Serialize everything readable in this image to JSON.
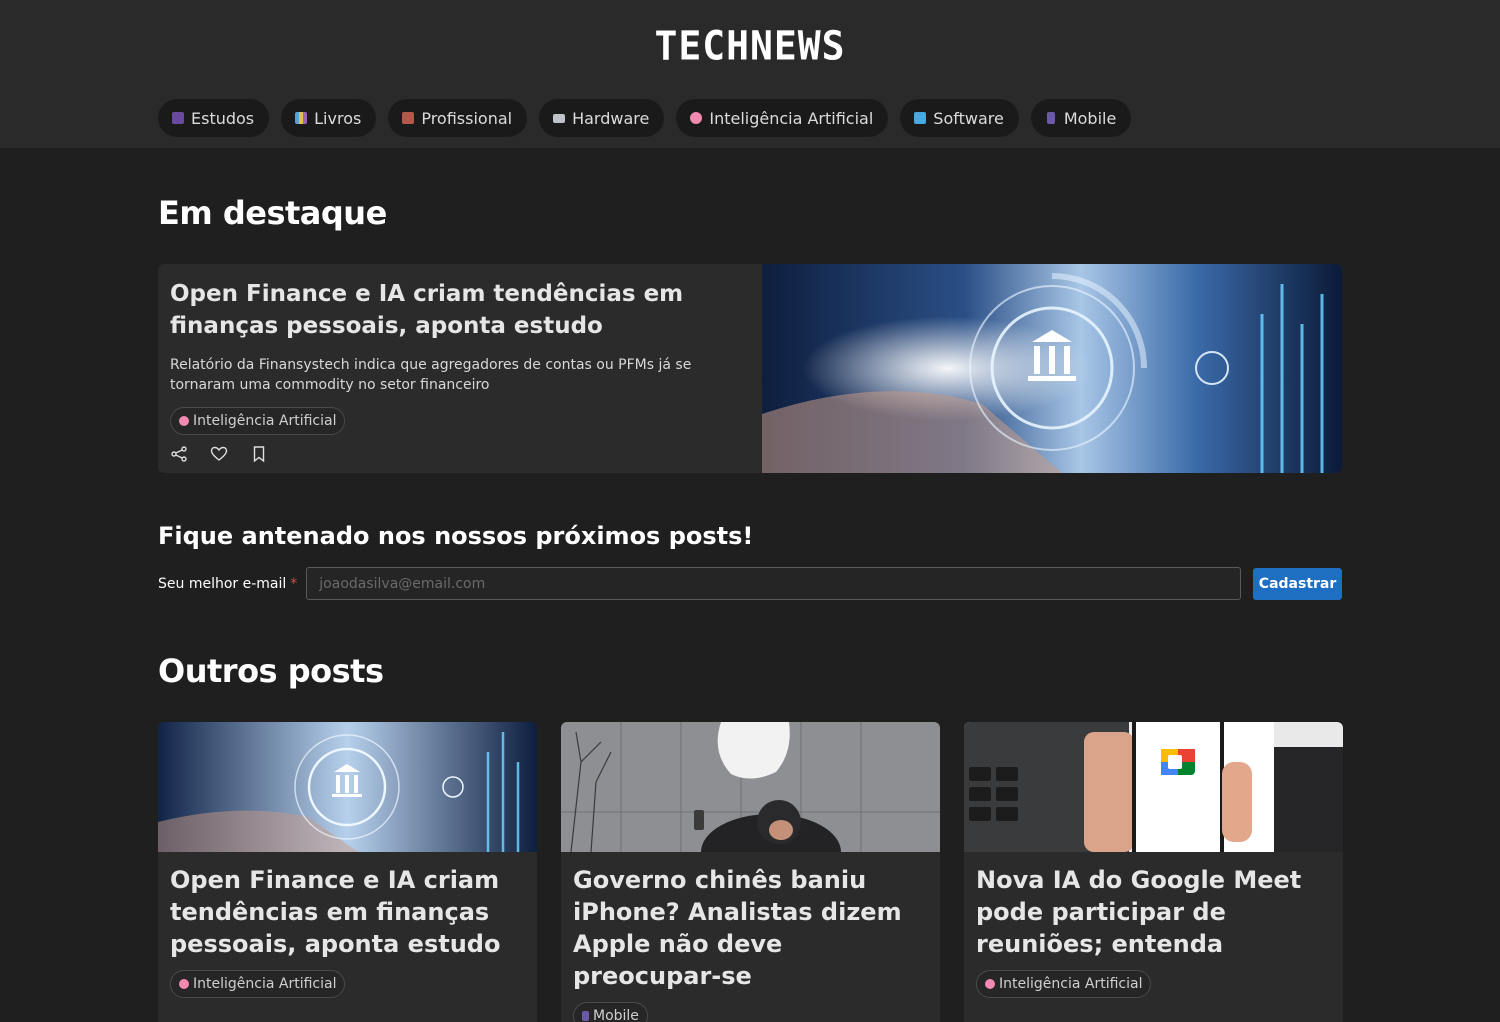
{
  "header": {
    "logo": "TECHNEWS",
    "categories": [
      {
        "label": "Estudos",
        "icon": "graduation-cap-icon",
        "color": "#6a4aa0"
      },
      {
        "label": "Livros",
        "icon": "books-icon",
        "color": "#5aa0d8"
      },
      {
        "label": "Profissional",
        "icon": "briefcase-icon",
        "color": "#b4584a"
      },
      {
        "label": "Hardware",
        "icon": "keyboard-icon",
        "color": "#bfc3c8"
      },
      {
        "label": "Inteligência Artificial",
        "icon": "brain-icon",
        "color": "#f08ab0"
      },
      {
        "label": "Software",
        "icon": "laptop-icon",
        "color": "#4aa8e0"
      },
      {
        "label": "Mobile",
        "icon": "mobile-phone-icon",
        "color": "#6a5aa8"
      }
    ]
  },
  "featured_section": {
    "heading": "Em destaque",
    "post": {
      "title": "Open Finance e IA criam tendências em finanças pessoais, aponta estudo",
      "description": "Relatório da Finansystech indica que agregadores de contas ou PFMs já se tornaram uma commodity no setor financeiro",
      "tag": "Inteligência Artificial",
      "tag_icon": "brain-icon"
    }
  },
  "newsletter": {
    "heading": "Fique antenado nos nossos próximos posts!",
    "label": "Seu melhor e-mail",
    "required_mark": "*",
    "placeholder": "joaodasilva@email.com",
    "button": "Cadastrar"
  },
  "other_section": {
    "heading": "Outros posts",
    "posts": [
      {
        "title": "Open Finance e IA criam tendências em finanças pessoais, aponta estudo",
        "tag": "Inteligência Artificial",
        "tag_color": "#f08ab0"
      },
      {
        "title": "Governo chinês baniu iPhone? Analistas dizem Apple não deve preocupar-se",
        "tag": "Mobile",
        "tag_color": "#6a5aa8"
      },
      {
        "title": "Nova IA do Google Meet pode participar de reuniões; entenda",
        "tag": "Inteligência Artificial",
        "tag_color": "#f08ab0"
      }
    ]
  },
  "colors": {
    "background": "#1f1f1f",
    "header_bg": "#2a2a2a",
    "card_bg": "#2b2b2b",
    "accent_button": "#1e6fc1"
  }
}
